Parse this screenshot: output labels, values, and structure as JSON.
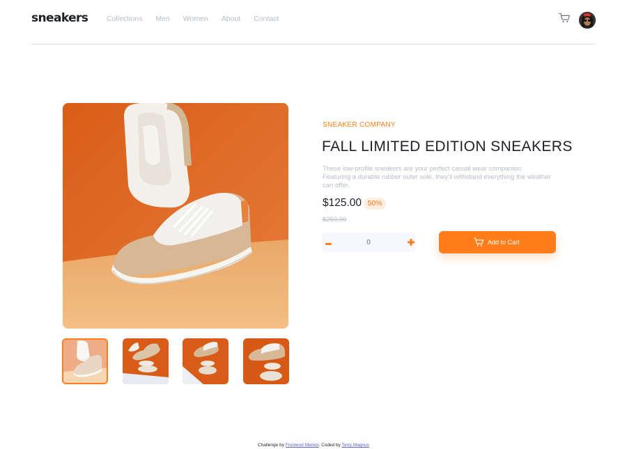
{
  "header": {
    "logo": "sneakers",
    "nav": [
      "Collections",
      "Men",
      "Women",
      "About",
      "Contact"
    ],
    "cart_icon": "cart-icon",
    "avatar_icon": "avatar"
  },
  "product": {
    "company": "SNEAKER COMPANY",
    "title": "FALL LIMITED EDITION SNEAKERS",
    "description": "These low-profile sneakers are your perfect casual wear companion. Featuring a durable rubber outer sole, they'll withstand everything the weather can offer.",
    "price": "$125.00",
    "discount": "50%",
    "old_price": "$250.00",
    "quantity": "0",
    "add_to_cart": "Add to Cart"
  },
  "footer": {
    "challenge_prefix": "Challenge by",
    "challenge_link": "Frontend Mentor",
    "coded_prefix": ". Coded by",
    "coded_link": "Terry Magnus"
  },
  "colors": {
    "accent": "#ff7d1a",
    "accent_pale": "#ffede0",
    "text": "#1d2025",
    "muted": "#b6bcc8"
  }
}
